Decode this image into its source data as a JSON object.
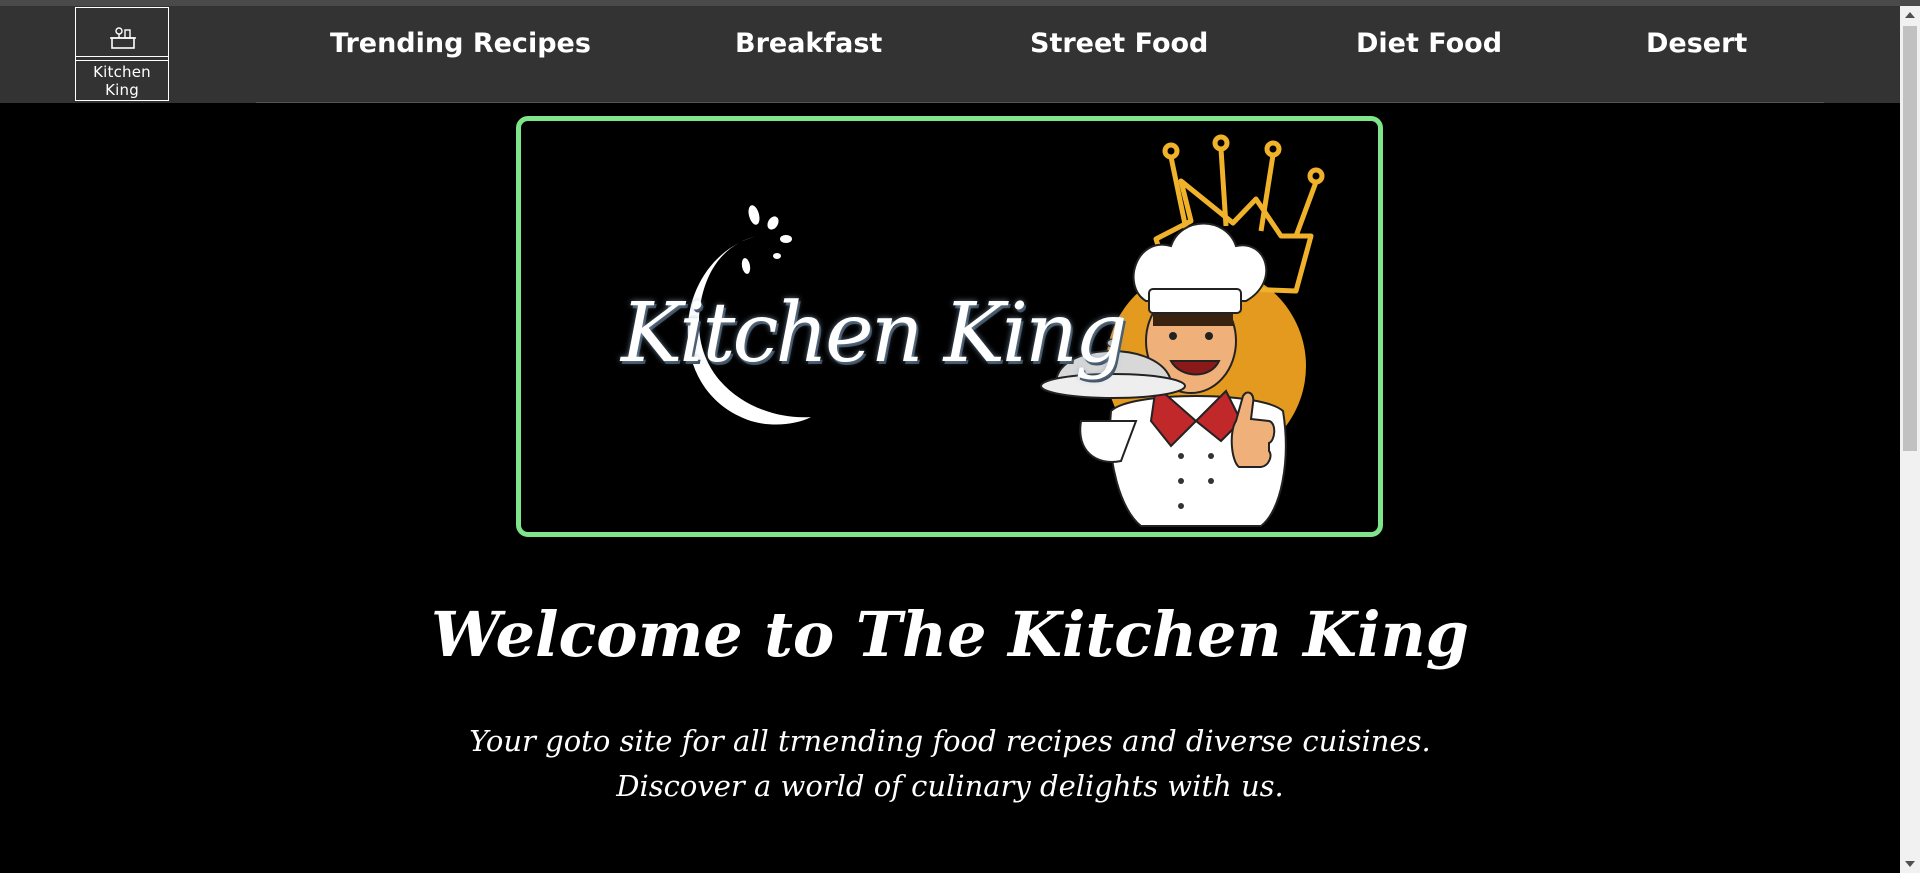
{
  "logo": {
    "text": "Kitchen King",
    "icon": "kitchen-pot-icon"
  },
  "nav": {
    "items": [
      {
        "label": "Trending Recipes"
      },
      {
        "label": "Breakfast"
      },
      {
        "label": "Street Food"
      },
      {
        "label": "Diet Food"
      },
      {
        "label": "Desert"
      }
    ]
  },
  "hero": {
    "brand_text": "Kitchen King",
    "illustration": "chef-with-crown-holding-cloche",
    "border_color": "#7ee58a"
  },
  "main": {
    "heading": "Welcome to The Kitchen King",
    "tagline_line1": "Your goto site for all trnending food recipes and diverse cuisines.",
    "tagline_line2": "Discover a world of culinary delights with us."
  },
  "colors": {
    "navbar": "#333333",
    "background": "#000000",
    "text": "#ffffff",
    "accent_gold": "#e8a020"
  }
}
